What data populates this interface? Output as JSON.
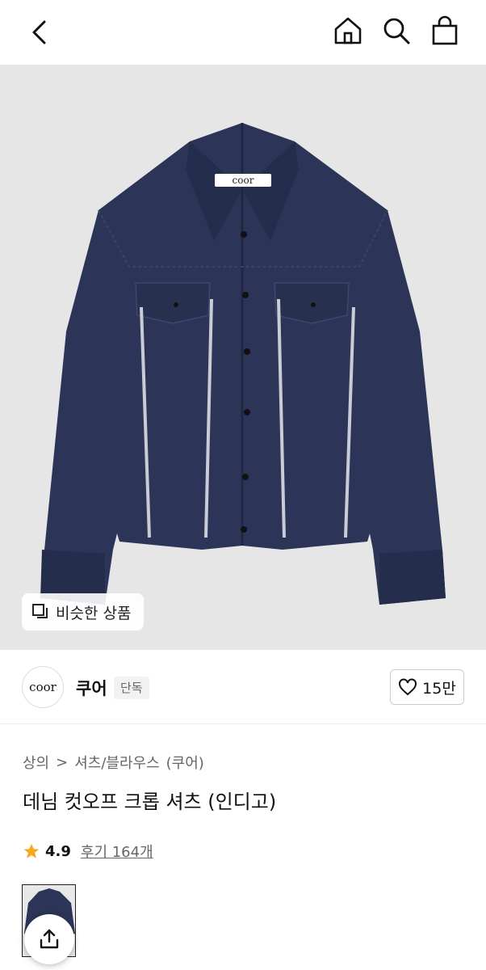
{
  "header": {
    "back_icon": "chevron-left-icon",
    "icons": [
      "home-icon",
      "search-icon",
      "shopping-bag-icon"
    ]
  },
  "hero": {
    "garment_label": "coor",
    "similar_button_label": "비슷한 상품",
    "background_color": "#e6e6e6",
    "garment_color": "#2c3558"
  },
  "brand": {
    "logo_text": "coor",
    "name": "쿠어",
    "tag": "단독",
    "like_count": "15만"
  },
  "product": {
    "breadcrumb": [
      "상의",
      "셔츠/블라우스",
      "(쿠어)"
    ],
    "title": "데님 컷오프 크롭 셔츠 (인디고)",
    "rating": "4.9",
    "reviews_label": "후기 164개"
  }
}
